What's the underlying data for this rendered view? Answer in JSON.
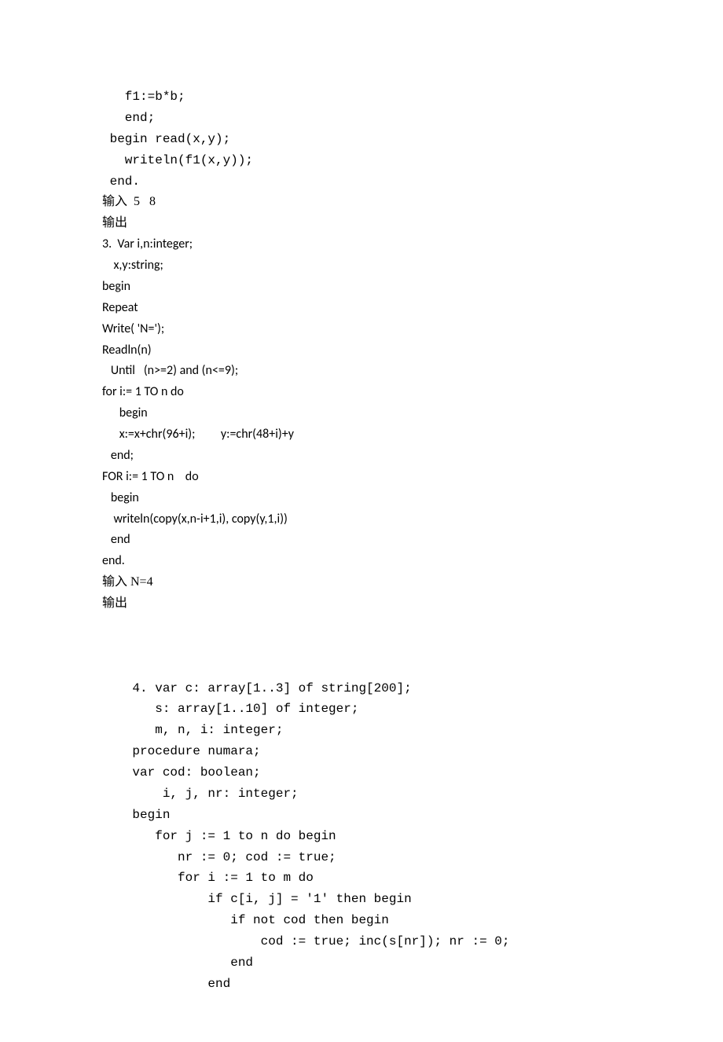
{
  "lines": [
    {
      "cls": "mono",
      "text": "   f1:=b*b;"
    },
    {
      "cls": "mono",
      "text": "   end;"
    },
    {
      "cls": "mono",
      "text": " begin read(x,y);"
    },
    {
      "cls": "mono",
      "text": "   writeln(f1(x,y));"
    },
    {
      "cls": "mono",
      "text": " end."
    },
    {
      "cls": "",
      "text": "输入  5   8"
    },
    {
      "cls": "",
      "text": "输出"
    },
    {
      "cls": "sans",
      "text": "3.  Var i,n:integer;"
    },
    {
      "cls": "sans",
      "text": "    x,y:string;"
    },
    {
      "cls": "sans",
      "text": "begin"
    },
    {
      "cls": "sans",
      "text": "Repeat"
    },
    {
      "cls": "sans",
      "text": "Write( 'N=');"
    },
    {
      "cls": "sans",
      "text": "Readln(n)"
    },
    {
      "cls": "sans",
      "text": "   Until   (n>=2) and (n<=9);"
    },
    {
      "cls": "sans",
      "text": "for i:= 1 TO n do"
    },
    {
      "cls": "sans",
      "text": "      begin"
    },
    {
      "cls": "sans",
      "text": "      x:=x+chr(96+i);         y:=chr(48+i)+y"
    },
    {
      "cls": "sans",
      "text": "   end;"
    },
    {
      "cls": "sans",
      "text": "FOR i:= 1 TO n    do"
    },
    {
      "cls": "sans",
      "text": "   begin"
    },
    {
      "cls": "sans",
      "text": "    writeln(copy(x,n-i+1,i), copy(y,1,i))"
    },
    {
      "cls": "sans",
      "text": "   end"
    },
    {
      "cls": "sans",
      "text": "end."
    },
    {
      "cls": "",
      "text": "输入 N=4"
    },
    {
      "cls": "",
      "text": "输出"
    },
    {
      "cls": "",
      "text": " "
    },
    {
      "cls": "",
      "text": " "
    },
    {
      "cls": "",
      "text": " "
    },
    {
      "cls": "mono",
      "text": "    4. var c: array[1..3] of string[200];"
    },
    {
      "cls": "mono",
      "text": "       s: array[1..10] of integer;"
    },
    {
      "cls": "mono",
      "text": "       m, n, i: integer;"
    },
    {
      "cls": "mono",
      "text": "    procedure numara;"
    },
    {
      "cls": "mono",
      "text": "    var cod: boolean;"
    },
    {
      "cls": "mono",
      "text": "        i, j, nr: integer;"
    },
    {
      "cls": "mono",
      "text": "    begin"
    },
    {
      "cls": "mono",
      "text": "       for j := 1 to n do begin"
    },
    {
      "cls": "mono",
      "text": "          nr := 0; cod := true;"
    },
    {
      "cls": "mono",
      "text": "          for i := 1 to m do"
    },
    {
      "cls": "mono",
      "text": "              if c[i, j] = '1' then begin"
    },
    {
      "cls": "mono",
      "text": "                 if not cod then begin"
    },
    {
      "cls": "mono",
      "text": "                     cod := true; inc(s[nr]); nr := 0;"
    },
    {
      "cls": "mono",
      "text": "                 end"
    },
    {
      "cls": "mono",
      "text": "              end"
    }
  ]
}
